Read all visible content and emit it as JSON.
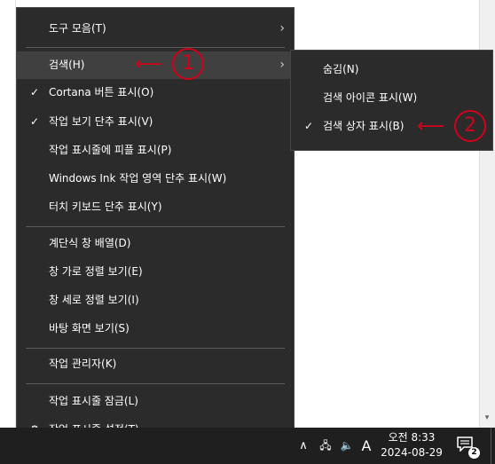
{
  "main_menu": {
    "items": [
      {
        "label": "도구 모음(T)",
        "check": "",
        "arrow": "›"
      },
      {
        "label": "검색(H)",
        "check": "",
        "arrow": "›"
      },
      {
        "label": "Cortana 버튼 표시(O)",
        "check": "✓",
        "arrow": ""
      },
      {
        "label": "작업 보기 단추 표시(V)",
        "check": "✓",
        "arrow": ""
      },
      {
        "label": "작업 표시줄에 피플 표시(P)",
        "check": "",
        "arrow": ""
      },
      {
        "label": "Windows Ink 작업 영역 단추 표시(W)",
        "check": "",
        "arrow": ""
      },
      {
        "label": "터치 키보드 단추 표시(Y)",
        "check": "",
        "arrow": ""
      },
      {
        "label": "계단식 창 배열(D)",
        "check": "",
        "arrow": ""
      },
      {
        "label": "창 가로 정렬 보기(E)",
        "check": "",
        "arrow": ""
      },
      {
        "label": "창 세로 정렬 보기(I)",
        "check": "",
        "arrow": ""
      },
      {
        "label": "바탕 화면 보기(S)",
        "check": "",
        "arrow": ""
      },
      {
        "label": "작업 관리자(K)",
        "check": "",
        "arrow": ""
      },
      {
        "label": "작업 표시줄 잠금(L)",
        "check": "",
        "arrow": ""
      },
      {
        "label": "작업 표시줄 설정(T)",
        "check": "⚙",
        "arrow": ""
      }
    ]
  },
  "sub_menu": {
    "items": [
      {
        "label": "숨김(N)",
        "check": ""
      },
      {
        "label": "검색 아이콘 표시(W)",
        "check": ""
      },
      {
        "label": "검색 상자 표시(B)",
        "check": "✓"
      }
    ]
  },
  "annotations": {
    "arrow_glyph": "⟵",
    "marker_1": "1",
    "marker_2": "2",
    "color": "#d0021b"
  },
  "taskbar": {
    "tray_chevron": "∧",
    "network_icon": "🖧",
    "volume_icon": "🔈",
    "input_indicator": "A",
    "clock_time": "오전 8:33",
    "clock_date": "2024-08-29",
    "notification_count": "2"
  },
  "scrollbar": {
    "down_arrow": "▾"
  }
}
